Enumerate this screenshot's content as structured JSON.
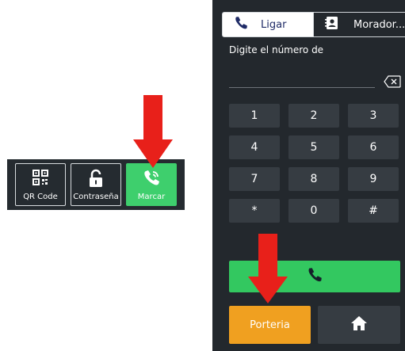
{
  "mini_toolbar": {
    "qr": {
      "label": "QR Code",
      "icon": "qr-code-icon"
    },
    "password": {
      "label": "Contraseña",
      "icon": "lock-icon"
    },
    "call": {
      "label": "Marcar",
      "icon": "phone-ringing-icon",
      "color": "#3ecf6d"
    }
  },
  "tabs": [
    {
      "label": "Ligar",
      "icon": "phone-icon",
      "active": true
    },
    {
      "label": "Morador...",
      "icon": "contact-card-icon",
      "active": false
    }
  ],
  "prompt": "Digite el número de",
  "number_input": {
    "value": ""
  },
  "keypad": [
    "1",
    "2",
    "3",
    "4",
    "5",
    "6",
    "7",
    "8",
    "9",
    "*",
    "0",
    "#"
  ],
  "actions": {
    "call": {
      "icon": "phone-icon",
      "color": "#33c860"
    },
    "porteria": {
      "label": "Porteria",
      "color": "#f0a020"
    },
    "home": {
      "icon": "home-icon"
    }
  },
  "annotation_color": "#e8201a"
}
